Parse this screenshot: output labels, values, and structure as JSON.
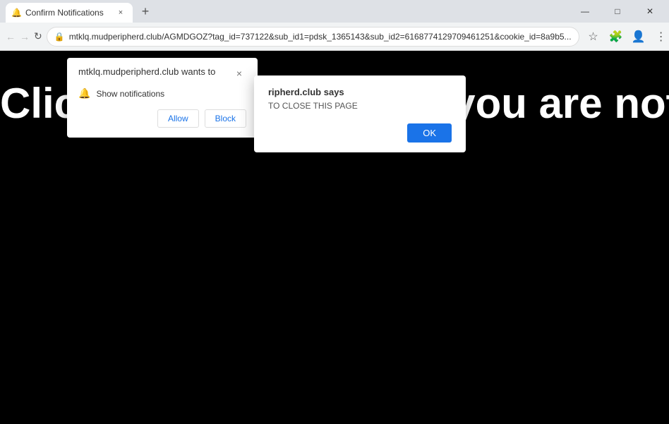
{
  "browser": {
    "tab": {
      "favicon": "🔔",
      "title": "Confirm Notifications",
      "close_label": "×"
    },
    "new_tab_label": "+",
    "window_controls": {
      "minimize": "—",
      "maximize": "□",
      "close": "✕"
    },
    "nav": {
      "back": "←",
      "forward": "→",
      "refresh": "↻"
    },
    "address": {
      "url": "mtklq.mudperipherd.club/AGMDGOZ?tag_id=737122&sub_id1=pdsk_1365143&sub_id2=6168774129709461251&cookie_id=8a9b5...",
      "lock_icon": "🔒"
    },
    "toolbar": {
      "star_icon": "☆",
      "extensions_icon": "🧩",
      "account_icon": "👤",
      "menu_icon": "⋮"
    }
  },
  "page": {
    "background_text": "Clic   ripherd.club says   you are not"
  },
  "notification_dialog": {
    "title": "mtklq.mudperipherd.club wants to",
    "close_label": "×",
    "permission_icon": "🔔",
    "permission_text": "Show notifications",
    "allow_label": "Allow",
    "block_label": "Block"
  },
  "alert_dialog": {
    "title": "ripherd.club says",
    "message": "TO CLOSE THIS PAGE",
    "ok_label": "OK"
  }
}
